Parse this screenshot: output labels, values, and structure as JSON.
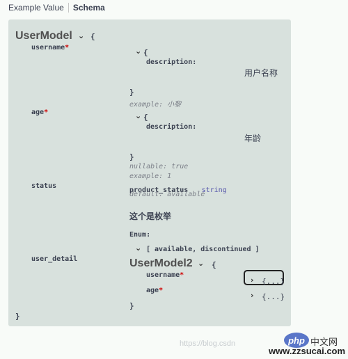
{
  "tabs": {
    "example_value": "Example Value",
    "schema": "Schema"
  },
  "model": {
    "title": "UserModel",
    "open_brace": "{",
    "close_brace": "}",
    "required_mark": "*",
    "properties": {
      "username": {
        "name": "username",
        "open_brace": "{",
        "description_key": "description:",
        "description_value": "用户名称",
        "close_brace": "}",
        "example": "example: 小黎"
      },
      "age": {
        "name": "age",
        "open_brace": "{",
        "description_key": "description:",
        "description_value": "年龄",
        "close_brace": "}",
        "nullable": "nullable: true",
        "example": "example: 1"
      },
      "status": {
        "name": "status",
        "type_name": "product_status",
        "type_primitive": "string",
        "default": "default: available",
        "description": "这个是枚举",
        "enum_label": "Enum:",
        "enum_values": "[ available, discontinued ]"
      },
      "user_detail": {
        "name": "user_detail",
        "model_title": "UserModel2",
        "open_brace": "{",
        "close_brace": "}",
        "nested": {
          "username": {
            "name": "username",
            "collapsed": "{...}"
          },
          "age": {
            "name": "age",
            "collapsed": "{...}"
          }
        }
      }
    }
  },
  "watermark": {
    "url": "https://blog.csdn",
    "logo": "php",
    "cn_site": "中文网",
    "domain": "www.zzsucai.com"
  }
}
